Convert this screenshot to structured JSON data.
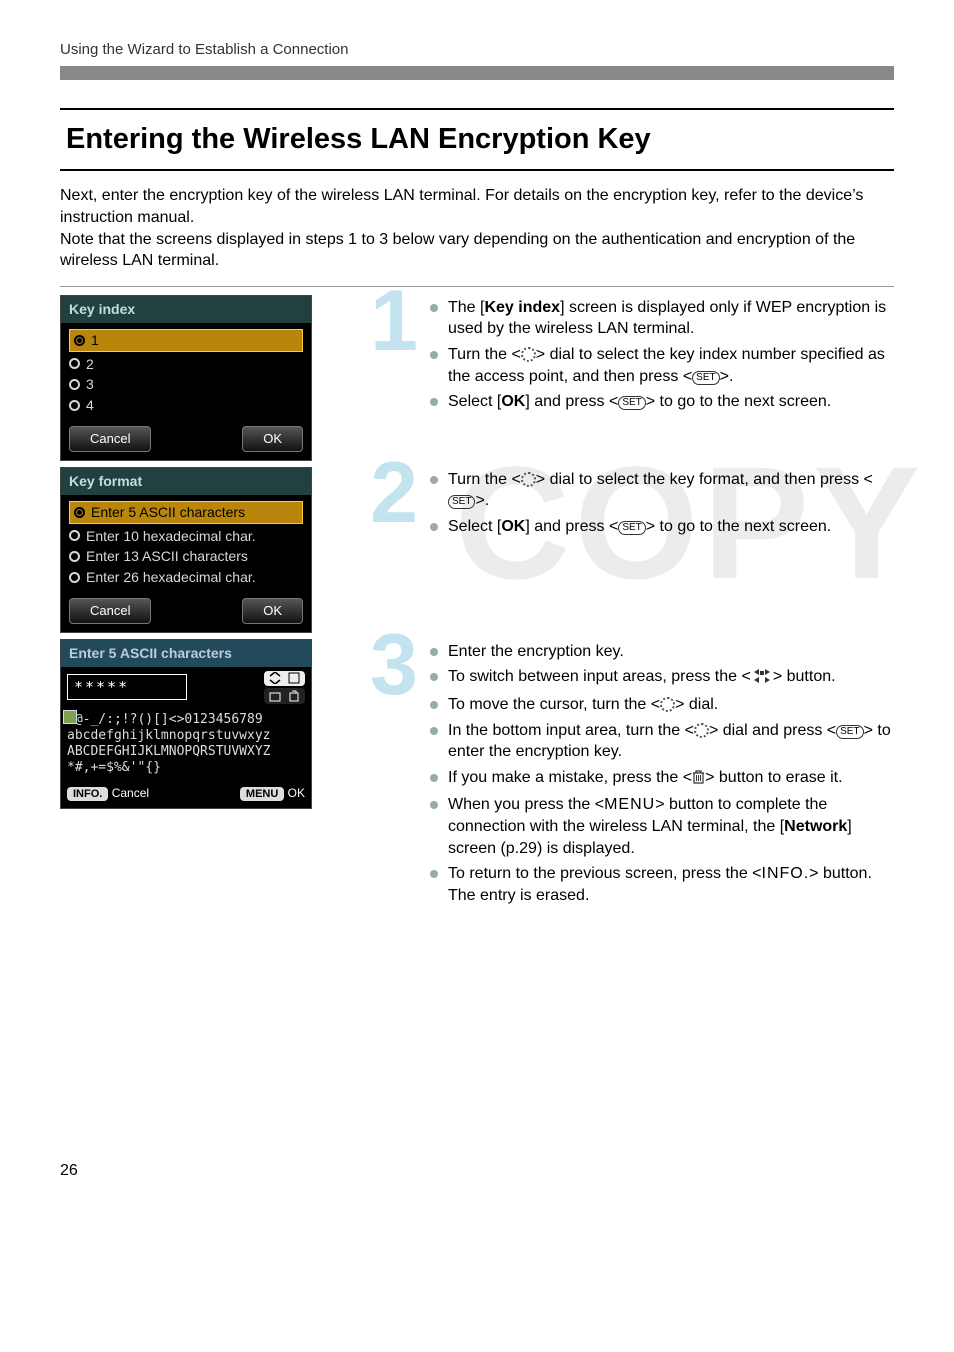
{
  "header": {
    "breadcrumb": "Using the Wizard to Establish a Connection"
  },
  "title": "Entering the Wireless LAN Encryption Key",
  "intro": "Next, enter the encryption key of the wireless LAN terminal. For details on the encryption key, refer to the device’s instruction manual.\nNote that the screens displayed in steps 1 to 3 below vary depending on the authentication and encryption of the wireless LAN terminal.",
  "watermark": "COPY",
  "screen1": {
    "header": "Key index",
    "items": [
      "1",
      "2",
      "3",
      "4"
    ],
    "cancel": "Cancel",
    "ok": "OK"
  },
  "screen2": {
    "header": "Key format",
    "items": [
      "Enter 5 ASCII characters",
      "Enter 10 hexadecimal char.",
      "Enter 13 ASCII characters",
      "Enter 26 hexadecimal char."
    ],
    "cancel": "Cancel",
    "ok": "OK"
  },
  "screen3": {
    "header": "Enter 5 ASCII characters",
    "value": "*****",
    "rows": [
      " .@-_/:;!?()[]<>0123456789",
      "abcdefghijklmnopqrstuvwxyz",
      "ABCDEFGHIJKLMNOPQRSTUVWXYZ",
      "*#,+=$%&'\"{}"
    ],
    "infoLabel": "INFO.",
    "cancel": "Cancel",
    "menuLabel": "MENU",
    "ok": "OK"
  },
  "steps": {
    "n1": "1",
    "n2": "2",
    "n3": "3",
    "s1": {
      "b1a": "The [",
      "b1b": "Key index",
      "b1c": "] screen is displayed only if WEP encryption is used by the wireless LAN terminal.",
      "b2": "Turn the <",
      "b2b": "> dial to select the key index number specified as the access point, and then press <",
      "b2c": ">.",
      "b3a": "Select [",
      "b3b": "OK",
      "b3c": "] and press <",
      "b3d": "> to go to the next screen."
    },
    "s2": {
      "b1": "Turn the <",
      "b1b": "> dial to select the key format, and then press <",
      "b1c": ">.",
      "b2a": "Select [",
      "b2b": "OK",
      "b2c": "] and press <",
      "b2d": "> to go to the next screen."
    },
    "s3": {
      "b1": "Enter the encryption key.",
      "b2a": "To switch between input areas, press the <",
      "b2b": "> button.",
      "b3a": "To move the cursor, turn the <",
      "b3b": "> dial.",
      "b4a": "In the bottom input area, turn the <",
      "b4b": "> dial and press <",
      "b4c": "> to enter the encryption key.",
      "b5a": "If you make a mistake, press the <",
      "b5b": "> button to erase it.",
      "b6a": "When you press the <",
      "b6menu": "MENU",
      "b6b": "> button to complete the connection with the wireless LAN terminal, the [",
      "b6net": "Network",
      "b6c": "] screen (p.29) is displayed.",
      "b7a": "To return to the previous screen, press the <",
      "b7info": "INFO.",
      "b7b": "> button. The entry is erased."
    }
  },
  "pageNumber": "26"
}
